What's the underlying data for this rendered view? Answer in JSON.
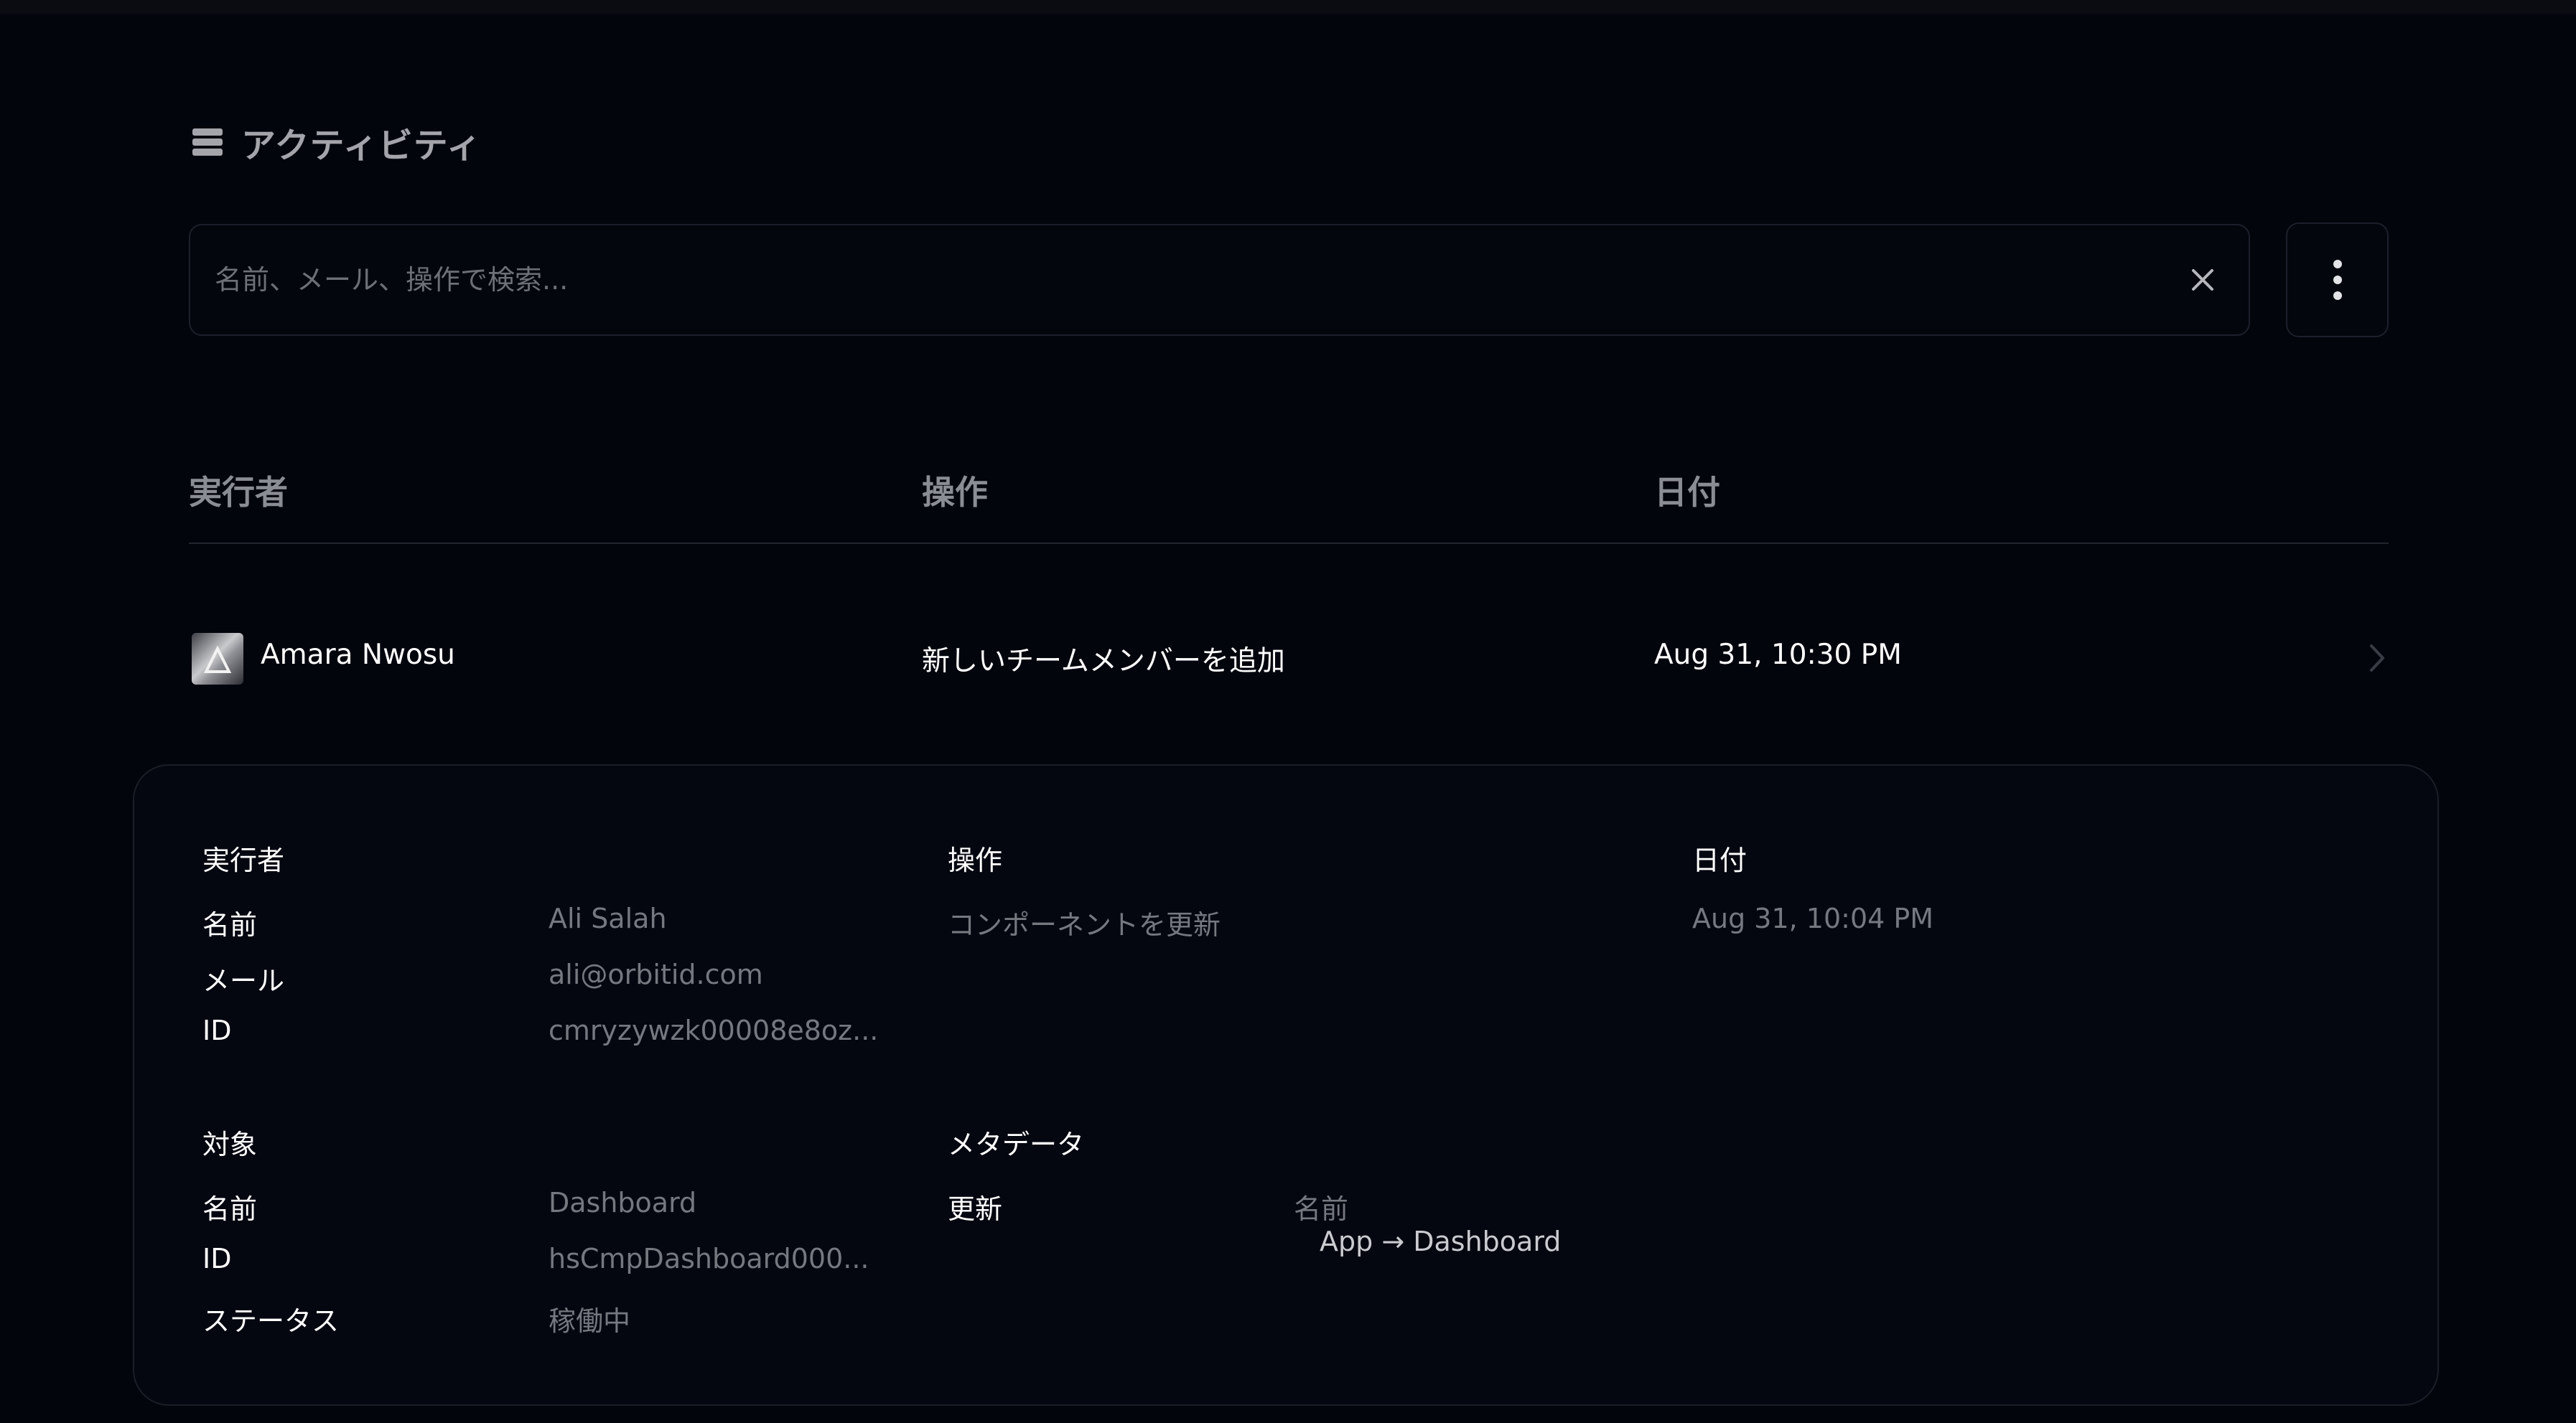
{
  "page": {
    "title": "アクティビティ",
    "title_icon": "database-icon"
  },
  "search": {
    "placeholder": "名前、メール、操作で検索...",
    "value": "",
    "clear_icon": "close-icon"
  },
  "toolbar": {
    "more_icon": "more-vertical-icon"
  },
  "table": {
    "columns": [
      "実行者",
      "操作",
      "日付"
    ],
    "rows": [
      {
        "actor": "Amara Nwosu",
        "action": "新しいチームメンバーを追加",
        "date": "Aug 31, 10:30 PM"
      }
    ]
  },
  "detail": {
    "actor": {
      "heading": "実行者",
      "fields": [
        {
          "label": "名前",
          "value": "Ali Salah"
        },
        {
          "label": "メール",
          "value": "ali@orbitid.com"
        },
        {
          "label": "ID",
          "value": "cmryzywzk00008e8oz..."
        }
      ]
    },
    "action": {
      "heading": "操作",
      "value": "コンポーネントを更新"
    },
    "date": {
      "heading": "日付",
      "value": "Aug 31, 10:04 PM"
    },
    "target": {
      "heading": "対象",
      "fields": [
        {
          "label": "名前",
          "value": "Dashboard"
        },
        {
          "label": "ID",
          "value": "hsCmpDashboard000..."
        },
        {
          "label": "ステータス",
          "value": "稼働中"
        }
      ]
    },
    "metadata": {
      "heading": "メタデータ",
      "update_label": "更新",
      "field_name": "名前",
      "change": "App → Dashboard"
    }
  }
}
